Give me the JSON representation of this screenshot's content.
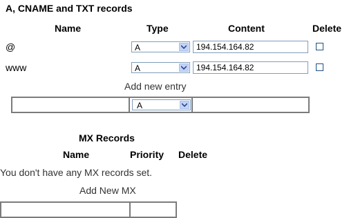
{
  "records_section": {
    "title": "A, CNAME and TXT records",
    "columns": {
      "name": "Name",
      "type": "Type",
      "content": "Content",
      "delete": "Delete"
    },
    "rows": [
      {
        "name": "@",
        "type": "A",
        "content": "194.154.164.82",
        "delete_checked": false
      },
      {
        "name": "www",
        "type": "A",
        "content": "194.154.164.82",
        "delete_checked": false
      }
    ],
    "add_label": "Add new entry",
    "new_entry": {
      "name": "",
      "type": "A",
      "content": ""
    }
  },
  "mx_section": {
    "title": "MX Records",
    "columns": {
      "name": "Name",
      "priority": "Priority",
      "delete": "Delete"
    },
    "empty_message": "You don't have any MX records set.",
    "add_label": "Add New MX",
    "new_entry": {
      "name": "",
      "priority": ""
    }
  },
  "icons": {
    "dropdown": "chevron-down-icon"
  }
}
